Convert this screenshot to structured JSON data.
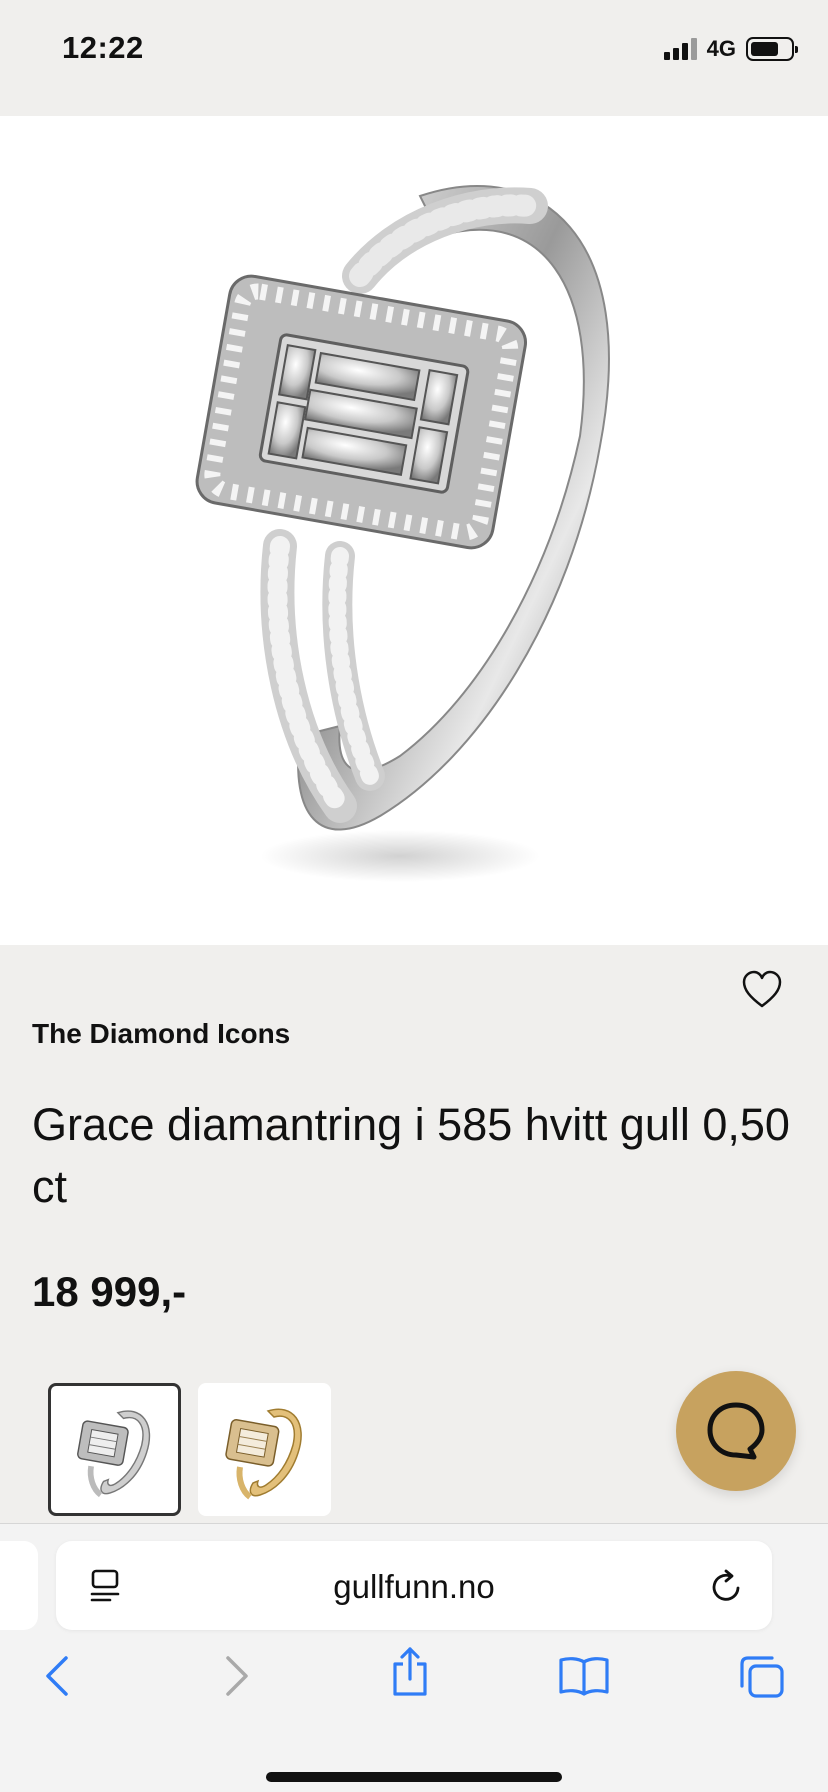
{
  "status_bar": {
    "time": "12:22",
    "network": "4G",
    "battery_level": 0.7
  },
  "product": {
    "brand": "The Diamond Icons",
    "title": "Grace diamantring i 585 hvitt gull 0,50 ct",
    "price": "18 999,-",
    "favorite_icon": "heart-outline-icon",
    "thumbnails": [
      {
        "variant": "white-gold",
        "selected": true
      },
      {
        "variant": "yellow-gold",
        "selected": false
      }
    ]
  },
  "chat": {
    "icon": "chat-bubble-icon",
    "color": "#c7a25f"
  },
  "browser": {
    "url": "gullfunn.no",
    "reader_icon": "reader-mode-icon",
    "reload_icon": "reload-icon",
    "toolbar": [
      "back-icon",
      "forward-icon",
      "share-icon",
      "bookmarks-icon",
      "tabs-icon"
    ],
    "accent_color": "#2f7cf6"
  }
}
